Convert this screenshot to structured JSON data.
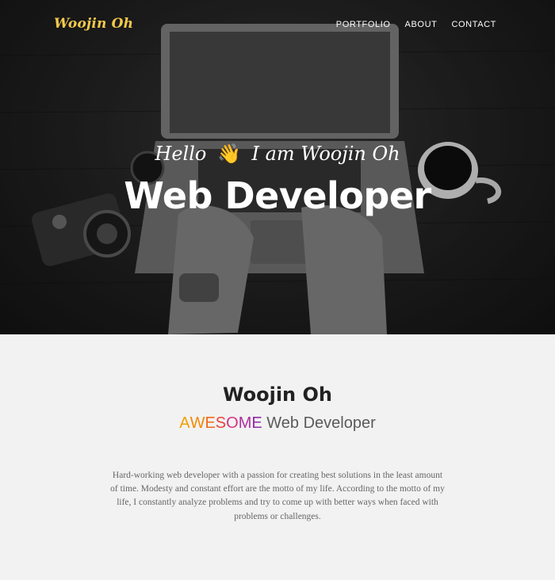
{
  "nav": {
    "brand": "Woojin Oh",
    "links": [
      "PORTFOLIO",
      "ABOUT",
      "CONTACT"
    ]
  },
  "hero": {
    "greeting_pre": "Hello",
    "wave_emoji": "👋",
    "greeting_post": "I am Woojin Oh",
    "headline": "Web Developer"
  },
  "about": {
    "name": "Woojin Oh",
    "awesome_letters": [
      "A",
      "W",
      "E",
      "S",
      "O",
      "M",
      "E"
    ],
    "role_rest": "Web Developer",
    "bio": "Hard-working web developer with a passion for creating best solutions in the least amount of time. Modesty and constant effort are the motto of my life. According to the motto of my life, I constantly analyze problems and try to come up with better ways when faced with problems or challenges."
  },
  "colors": {
    "brand": "#f2c94c",
    "awesome_gradient": [
      "#f2a000",
      "#f28a00",
      "#f06a1a",
      "#e8443c",
      "#d63384",
      "#b0309c",
      "#8e2ca8"
    ]
  }
}
